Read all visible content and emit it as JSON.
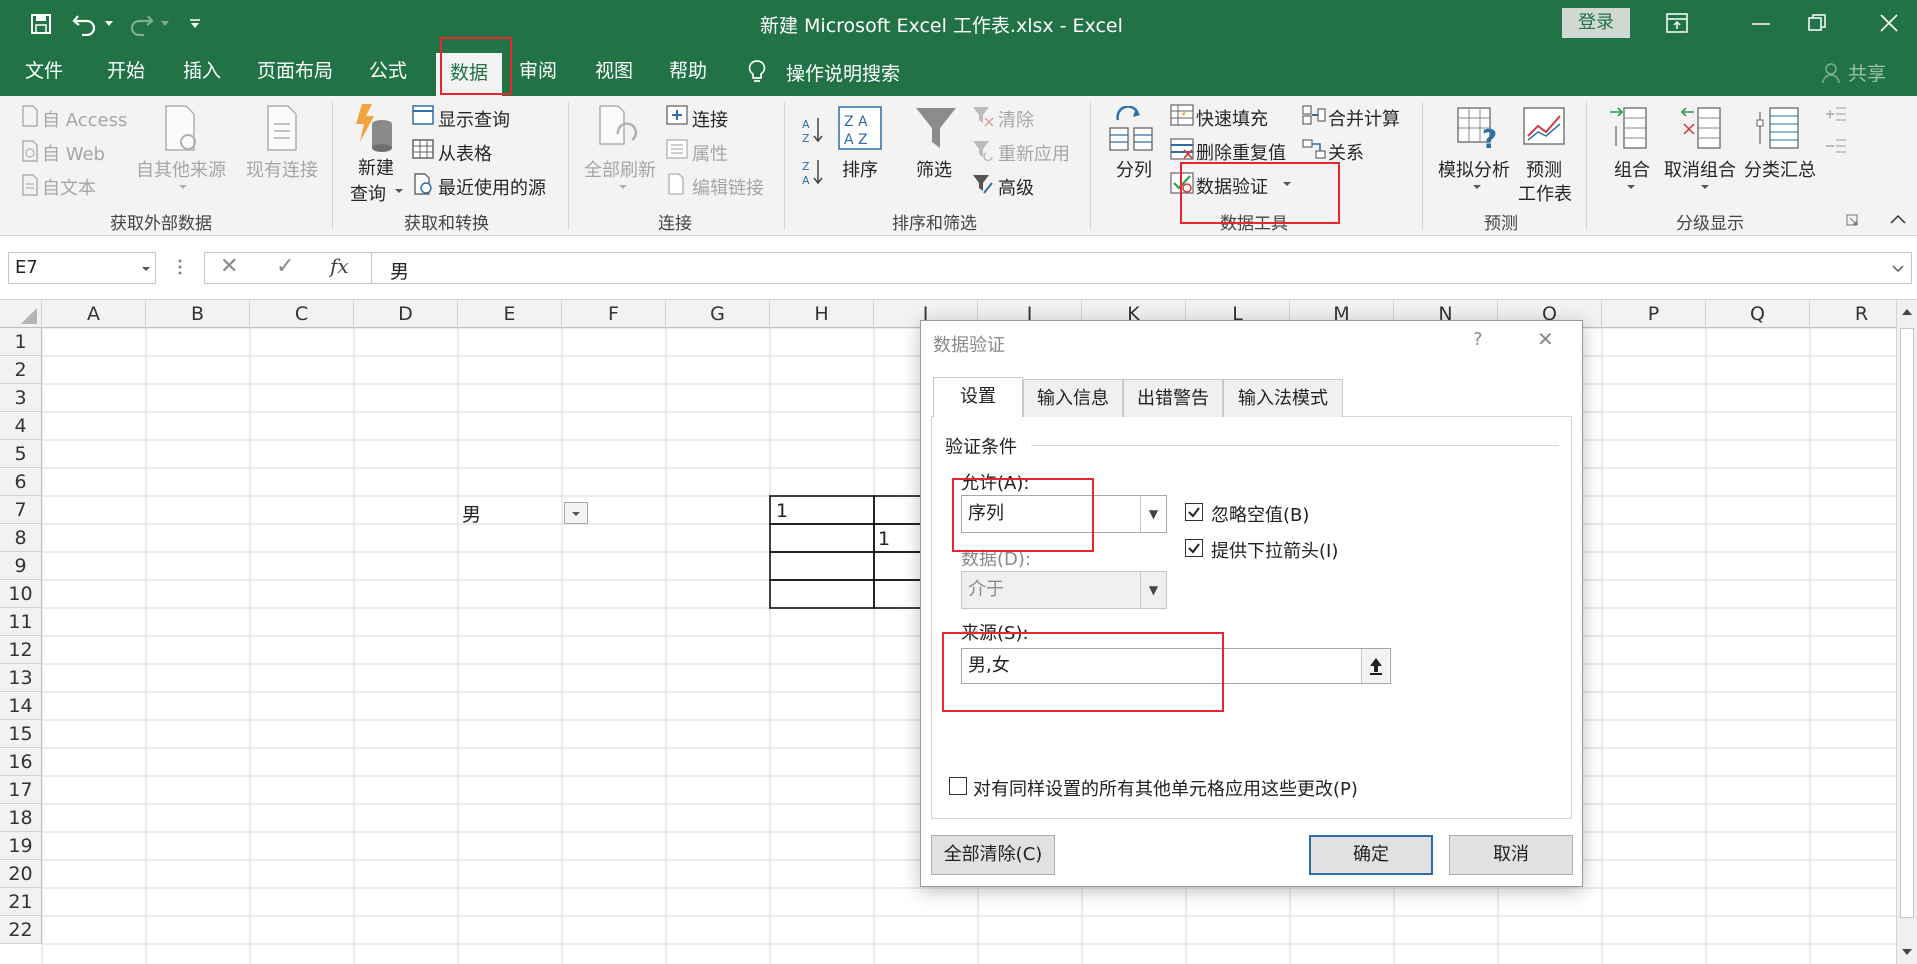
{
  "window": {
    "title": "新建 Microsoft Excel 工作表.xlsx  -  Excel",
    "login_label": "登录",
    "share_label": "共享"
  },
  "tabs": [
    {
      "label": "文件",
      "active": false
    },
    {
      "label": "开始",
      "active": false
    },
    {
      "label": "插入",
      "active": false
    },
    {
      "label": "页面布局",
      "active": false
    },
    {
      "label": "公式",
      "active": false
    },
    {
      "label": "数据",
      "active": true
    },
    {
      "label": "审阅",
      "active": false
    },
    {
      "label": "视图",
      "active": false
    },
    {
      "label": "帮助",
      "active": false
    }
  ],
  "tell_me": "操作说明搜索",
  "ribbon": {
    "get_external": {
      "label": "获取外部数据",
      "access": "自 Access",
      "web": "自 Web",
      "text": "自文本",
      "other": "自其他来源",
      "existing": "现有连接"
    },
    "get_transform": {
      "label": "获取和转换",
      "new_query_1": "新建",
      "new_query_2": "查询",
      "show_queries": "显示查询",
      "from_table": "从表格",
      "recent_sources": "最近使用的源"
    },
    "connections": {
      "label": "连接",
      "refresh_all": "全部刷新",
      "connections": "连接",
      "properties": "属性",
      "edit_links": "编辑链接"
    },
    "sort_filter": {
      "label": "排序和筛选",
      "sort": "排序",
      "filter": "筛选",
      "clear": "清除",
      "reapply": "重新应用",
      "advanced": "高级"
    },
    "data_tools": {
      "label": "数据工具",
      "text_to_columns": "分列",
      "flash_fill": "快速填充",
      "remove_duplicates": "删除重复值",
      "data_validation": "数据验证",
      "consolidate": "合并计算",
      "relationships": "关系"
    },
    "forecast": {
      "label": "预测",
      "what_if": "模拟分析",
      "forecast_sheet_1": "预测",
      "forecast_sheet_2": "工作表"
    },
    "outline": {
      "label": "分级显示",
      "group": "组合",
      "ungroup": "取消组合",
      "subtotal": "分类汇总"
    }
  },
  "formula_bar": {
    "name_box": "E7",
    "cancel_glyph": "✕",
    "enter_glyph": "✓",
    "fx_glyph": "fx",
    "content": "男"
  },
  "columns": [
    "A",
    "B",
    "C",
    "D",
    "E",
    "F",
    "G",
    "H",
    "I",
    "J",
    "K",
    "L",
    "M",
    "N",
    "O",
    "P",
    "Q",
    "R"
  ],
  "rows": [
    "1",
    "2",
    "3",
    "4",
    "5",
    "6",
    "7",
    "8",
    "9",
    "10",
    "11",
    "12",
    "13",
    "14",
    "15",
    "16",
    "17",
    "18",
    "19",
    "20",
    "21",
    "22"
  ],
  "cells": {
    "E7": "男",
    "H7": "1",
    "I8": "1"
  },
  "dialog": {
    "title": "数据验证",
    "help_glyph": "?",
    "close_glyph": "✕",
    "tabs": [
      "设置",
      "输入信息",
      "出错警告",
      "输入法模式"
    ],
    "section_title": "验证条件",
    "allow_label": "允许(A):",
    "allow_value": "序列",
    "data_label": "数据(D):",
    "data_value": "介于",
    "ignore_blank_label": "忽略空值(B)",
    "ignore_blank_checked": true,
    "dropdown_label": "提供下拉箭头(I)",
    "dropdown_checked": true,
    "source_label": "来源(S):",
    "source_value": "男,女",
    "apply_all_label": "对有同样设置的所有其他单元格应用这些更改(P)",
    "apply_all_checked": false,
    "clear_all_button": "全部清除(C)",
    "ok_button": "确定",
    "cancel_button": "取消"
  },
  "colors": {
    "excel_green": "#217346",
    "highlight_red": "#e8262e"
  }
}
